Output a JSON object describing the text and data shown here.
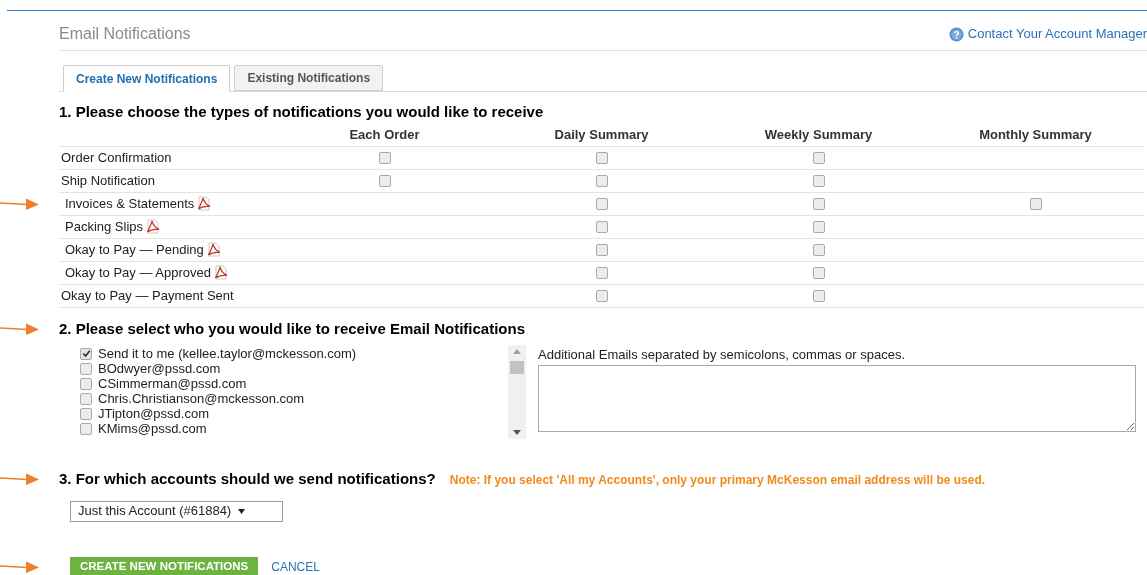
{
  "page": {
    "title": "Email Notifications",
    "help_link": "Contact Your Account Manager"
  },
  "tabs": [
    {
      "label": "Create New Notifications",
      "selected": true
    },
    {
      "label": "Existing Notifications",
      "selected": false
    }
  ],
  "section_1": {
    "heading": "1. Please choose the types of notifications you would like to receive",
    "columns": [
      "Each Order",
      "Daily Summary",
      "Weekly Summary",
      "Monthly Summary"
    ],
    "rows": [
      {
        "label": "Order Confirmation",
        "pdf": false,
        "marked": false,
        "each_order": {
          "checked": false
        },
        "daily_summary": {
          "checked": false
        },
        "weekly_summary": {
          "checked": false
        }
      },
      {
        "label": "Ship Notification",
        "pdf": false,
        "marked": false,
        "each_order": {
          "checked": false
        },
        "daily_summary": {
          "checked": false
        },
        "weekly_summary": {
          "checked": false
        }
      },
      {
        "label": "Invoices & Statements",
        "pdf": true,
        "marked": true,
        "daily_summary": {
          "checked": false
        },
        "weekly_summary": {
          "checked": false
        },
        "monthly_summary": {
          "checked": false
        }
      },
      {
        "label": "Packing Slips",
        "pdf": true,
        "marked": false,
        "daily_summary": {
          "checked": false
        },
        "weekly_summary": {
          "checked": false
        }
      },
      {
        "label": "Okay to Pay — Pending",
        "pdf": true,
        "marked": false,
        "daily_summary": {
          "checked": false
        },
        "weekly_summary": {
          "checked": false
        }
      },
      {
        "label": "Okay to Pay — Approved",
        "pdf": true,
        "marked": false,
        "daily_summary": {
          "checked": false
        },
        "weekly_summary": {
          "checked": false
        }
      },
      {
        "label": "Okay to Pay — Payment Sent",
        "pdf": false,
        "marked": false,
        "daily_summary": {
          "checked": false
        },
        "weekly_summary": {
          "checked": false
        }
      }
    ]
  },
  "section_2": {
    "heading": "2. Please select who you would like to receive Email Notifications",
    "marked": true,
    "recipients": [
      {
        "label": "Send it to me (kellee.taylor@mckesson.com)",
        "checked": true
      },
      {
        "label": "BOdwyer@pssd.com",
        "checked": false
      },
      {
        "label": "CSimmerman@pssd.com",
        "checked": false
      },
      {
        "label": "Chris.Christianson@mckesson.com",
        "checked": false
      },
      {
        "label": "JTipton@pssd.com",
        "checked": false
      },
      {
        "label": "KMims@pssd.com",
        "checked": false
      }
    ],
    "additional_label": "Additional Emails separated by semicolons, commas or spaces."
  },
  "section_3": {
    "heading": "3. For which accounts should we send notifications?",
    "marked": true,
    "note": "Note: If you select 'All my Accounts', only your primary McKesson email address will be used.",
    "account": "Just this Account (#61884)"
  },
  "actions": {
    "marked": true,
    "submit": "CREATE NEW NOTIFICATIONS",
    "cancel": "CANCEL"
  }
}
